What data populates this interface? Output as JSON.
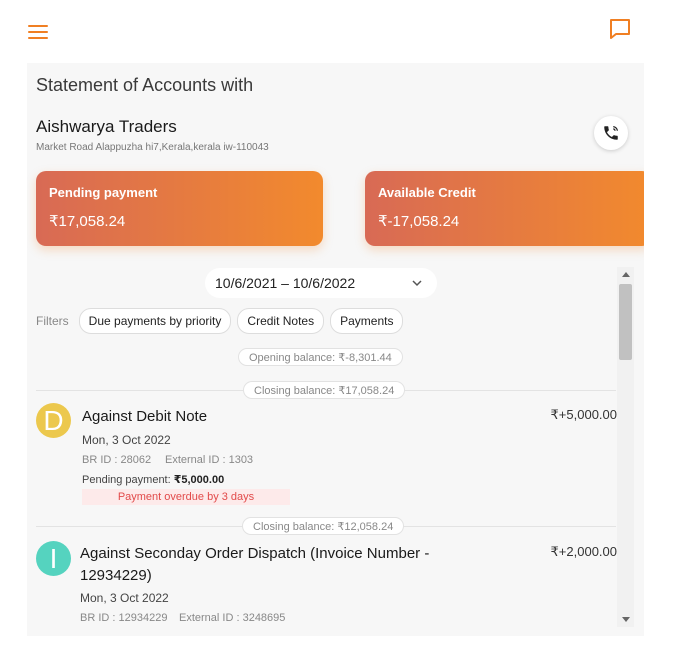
{
  "header": {
    "menu_icon": "hamburger-menu-icon",
    "chat_icon": "chat-bubble-icon",
    "accent": "#f07f23"
  },
  "statement": {
    "title": "Statement of Accounts with",
    "party_name": "Aishwarya Traders",
    "party_address": "Market Road Alappuzha hi7,Kerala,kerala iw-110043",
    "call_icon": "phone-call-icon"
  },
  "cards": {
    "pending": {
      "label": "Pending payment",
      "amount": "₹17,058.24"
    },
    "credit": {
      "label": "Available Credit",
      "amount": "₹-17,058.24"
    }
  },
  "date_range": {
    "value": "10/6/2021 – 10/6/2022"
  },
  "filters": {
    "label": "Filters",
    "chips": [
      "Due payments by priority",
      "Credit Notes",
      "Payments"
    ]
  },
  "balances": {
    "opening": "Opening balance: ₹-8,301.44",
    "closing_1": "Closing balance: ₹17,058.24",
    "closing_2": "Closing balance: ₹12,058.24"
  },
  "transactions": [
    {
      "initial": "D",
      "title": "Against Debit Note",
      "date": "Mon, 3 Oct 2022",
      "br_id": "BR ID : 28062",
      "external_id": "External ID : 1303",
      "pending_label": "Pending payment: ",
      "pending_amount": "₹5,000.00",
      "overdue": "Payment overdue by 3 days",
      "amount": "₹+5,000.00",
      "avatar_color": "#ecc84d"
    },
    {
      "initial": "I",
      "title_line1": "Against Seconday Order Dispatch (Invoice Number -",
      "title_line2": "12934229)",
      "date": "Mon, 3 Oct 2022",
      "br_id": "BR ID : 12934229",
      "external_id": "External ID : 3248695",
      "amount": "₹+2,000.00",
      "avatar_color": "#55d3bf"
    }
  ]
}
